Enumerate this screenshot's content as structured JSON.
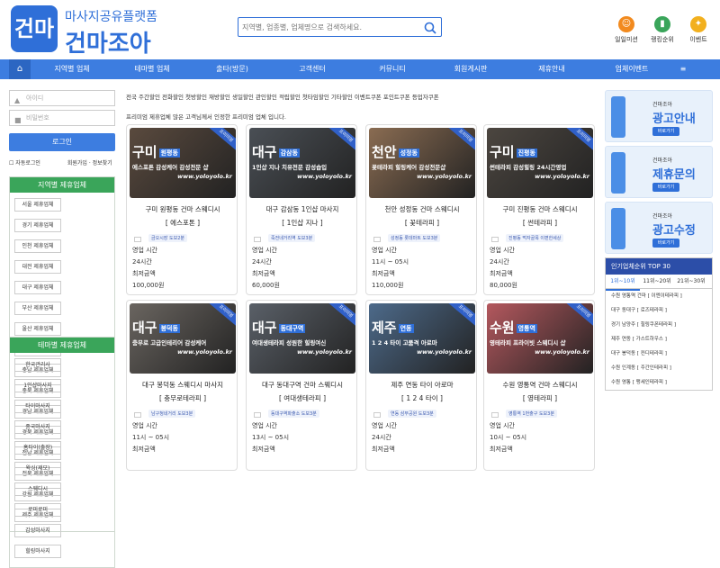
{
  "header": {
    "logo_mark": "건마",
    "logo_sub": "마사지공유플랫폼",
    "logo_main": "건마조아",
    "search_placeholder": "지역별, 업종별, 업체명으로 검색하세요.",
    "icons": [
      {
        "label": "일일미션",
        "icon": "smile-icon",
        "color": "#f28a1e"
      },
      {
        "label": "랭킹순위",
        "icon": "chart-icon",
        "color": "#3aa55a"
      },
      {
        "label": "이벤트",
        "icon": "gift-icon",
        "color": "#f2b01e"
      }
    ]
  },
  "nav": {
    "items": [
      "지역별 업체",
      "테마별 업체",
      "출타(방문)",
      "고객센터",
      "커뮤니티",
      "회원게시판",
      "제휴안내",
      "업체이벤트",
      "≡"
    ]
  },
  "login": {
    "id_placeholder": "아이디",
    "pw_placeholder": "비밀번호",
    "button": "로그인",
    "auto_login": "자동로그인",
    "links": "회원가입 · 정보찾기"
  },
  "region_panel": {
    "title": "지역별 제휴업체",
    "items": [
      "서울 제휴업체",
      "경기 제휴업체",
      "인천 제휴업체",
      "대전 제휴업체",
      "대구 제휴업체",
      "부산 제휴업체",
      "울산 제휴업체",
      "광주 제휴업체",
      "충남 제휴업체",
      "충북 제휴업체",
      "경남 제휴업체",
      "경북 제휴업체",
      "전남 제휴업체",
      "전북 제휴업체",
      "강원 제휴업체",
      "제주 제휴업체"
    ]
  },
  "theme_panel": {
    "title": "테마별 제휴업체",
    "items": [
      "한국관리사",
      "1인샵마사지",
      "타이마사지",
      "중국마사지",
      "홈타이(출장)",
      "왁싱(제모)",
      "스웨디시",
      "로미로미",
      "감성마사지",
      "힐링마사지"
    ]
  },
  "intro": {
    "line1": "전국 주간할인 전화할인 첫방할인 재방할인 생일할인 관인할인 적립할인 첫타임할인 기타할인 이벤트쿠폰 포인트쿠폰 등업자쿠폰",
    "line2": "프리미엄 제휴업체  많은 고객님께서 인정한 프리미엄 업체 입니다."
  },
  "cards": [
    {
      "region": "구미",
      "area": "원평동",
      "tagline": "에스포톤 감성케어 감성전문 샵",
      "site": "www.yoloyolo.kr",
      "ribbon": "프리미엄",
      "name": "구미 원평동 건마 스웨디시",
      "sub": "[ 에스포톤 ]",
      "loc": "금오시장 도보2분",
      "hours_label": "영업 시간",
      "hours": "24시간",
      "price_label": "최저금액",
      "price": "100,000원",
      "bg": "#5a4a3e"
    },
    {
      "region": "대구",
      "area": "감삼동",
      "tagline": "1인샵 지나 치유전문 감성숍입",
      "site": "www.yoloyolo.kr",
      "ribbon": "프리미엄",
      "name": "대구 감삼동 1인샵 마사지",
      "sub": "[ 1인샵 지나 ]",
      "loc": "죽전네거리역 도보3분",
      "hours_label": "영업 시간",
      "hours": "24시간",
      "price_label": "최저금액",
      "price": "60,000원",
      "bg": "#4a4f55"
    },
    {
      "region": "천안",
      "area": "성정동",
      "tagline": "꽃테라피 힐링케어 감성전문샵",
      "site": "www.yoloyolo.kr",
      "ribbon": "프리미엄",
      "name": "천안 성정동 건마 스웨디시",
      "sub": "[ 꽃테라피 ]",
      "loc": "성정동 롯데마트 도보3분",
      "hours_label": "영업 시간",
      "hours": "11시 ~ 05시",
      "price_label": "최저금액",
      "price": "110,000원",
      "bg": "#8a6c52"
    },
    {
      "region": "구미",
      "area": "진평동",
      "tagline": "썬테라피 감성힐링 24시간영업",
      "site": "www.yoloyolo.kr",
      "ribbon": "프리미엄",
      "name": "구미 진평동 건마 스웨디시",
      "sub": "[ 썬테라피 ]",
      "loc": "진평동 먹자골목 이편한세상",
      "hours_label": "영업 시간",
      "hours": "24시간",
      "price_label": "최저금액",
      "price": "80,000원",
      "bg": "#4c4640"
    },
    {
      "region": "대구",
      "area": "봉덕동",
      "tagline": "충무로 고급인테리어 감성케어",
      "site": "www.yoloyolo.kr",
      "ribbon": "프리미엄",
      "name": "대구 봉덕동 스웨디시 마사지",
      "sub": "[ 충무로테라피 ]",
      "loc": "남구청네거리 도보3분",
      "hours_label": "영업 시간",
      "hours": "11시 ~ 05시",
      "price_label": "최저금액",
      "price": "",
      "bg": "#6a6560"
    },
    {
      "region": "대구",
      "area": "동대구역",
      "tagline": "여대생테라피 성원한 힐링여신",
      "site": "www.yoloyolo.kr",
      "ribbon": "프리미엄",
      "name": "대구 동대구역 건마 스웨디시",
      "sub": "[ 여대생테라피 ]",
      "loc": "동대구역파출소 도보3분",
      "hours_label": "영업 시간",
      "hours": "13시 ~ 05시",
      "price_label": "최저금액",
      "price": "",
      "bg": "#5a6068"
    },
    {
      "region": "제주",
      "area": "연동",
      "tagline": "1 2 4 타이 고품격 아로마",
      "site": "www.yoloyolo.kr",
      "ribbon": "프리미엄",
      "name": "제주 연동 타이 아로마",
      "sub": "[ 1 2 4 타이 ]",
      "loc": "연동 삼무공원 도보3분",
      "hours_label": "영업 시간",
      "hours": "24시간",
      "price_label": "최저금액",
      "price": "",
      "bg": "#4d6a8a"
    },
    {
      "region": "수원",
      "area": "영통역",
      "tagline": "영테라피 프라이빗 스웨디시 샵",
      "site": "www.yoloyolo.kr",
      "ribbon": "프리미엄",
      "name": "수원 영통역 건마 스웨디시",
      "sub": "[ 영테라피 ]",
      "loc": "영통역 1번출구 도보3분",
      "hours_label": "영업 시간",
      "hours": "10시 ~ 05시",
      "price_label": "최저금액",
      "price": "",
      "bg": "#b4585e"
    }
  ],
  "ads": [
    {
      "brand": "건마조아",
      "title": "광고안내",
      "btn": "바로가기"
    },
    {
      "brand": "건마조아",
      "title": "제휴문의",
      "btn": "바로가기"
    },
    {
      "brand": "건마조아",
      "title": "광고수정",
      "btn": "바로가기"
    }
  ],
  "top30": {
    "title": "인기업체순위 TOP 30",
    "tabs": [
      "1위~10위",
      "11위~20위",
      "21위~30위"
    ],
    "ranks": [
      "수원 영통역 건마 [ 이엔이테라피 ]",
      "대구 동대구 [ 로즈테라피 ]",
      "경기 남양주 [ 힐링쿠폰테라피 ]",
      "제주 연동 [ 가스트하우스 ]",
      "대구 봉덕동 [ 컨디테라피 ]",
      "수원 인계동 [ 주간인테라피 ]",
      "수원 영통 [ 맹세인테라피 ]"
    ]
  }
}
